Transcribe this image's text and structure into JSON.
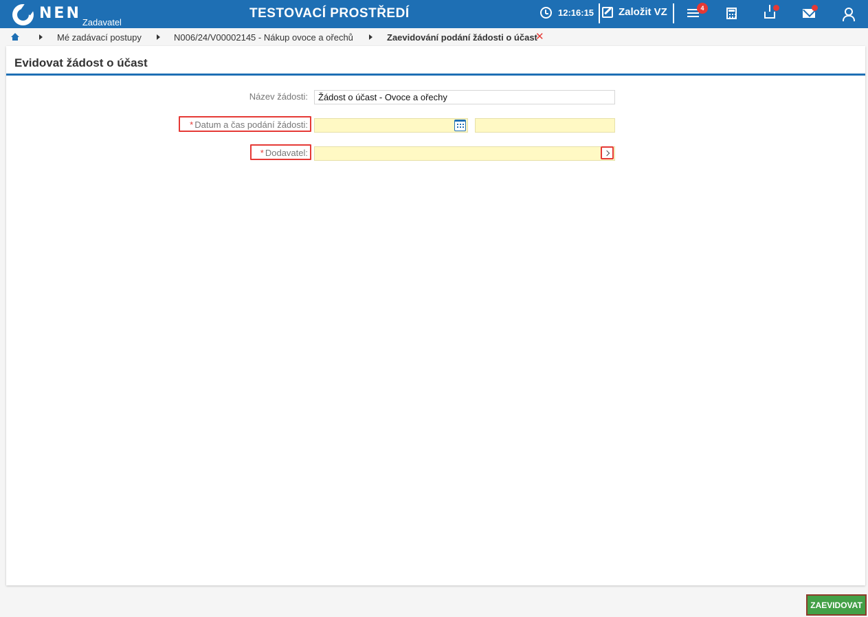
{
  "header": {
    "logo_text": "NEN",
    "logo_sub": "Zadavatel",
    "environment": "TESTOVACÍ PROSTŘEDÍ",
    "time": "12:16:15",
    "create_label": "Založit VZ",
    "notification_count": "4",
    "accent_color": "#1e6fb4"
  },
  "breadcrumb": {
    "items": [
      "Mé zadávací postupy",
      "N006/24/V00002145 - Nákup ovoce a ořechů",
      "Zaevidování podání žádosti o účast"
    ]
  },
  "page": {
    "title": "Evidovat žádost o účast"
  },
  "form": {
    "name_label": "Název žádosti:",
    "name_value": "Žádost o účast - Ovoce a ořechy",
    "datetime_star": "*",
    "datetime_label": "Datum a čas podání žádosti:",
    "date_value": "",
    "time_value": "",
    "supplier_star": "*",
    "supplier_label": "Dodavatel:",
    "supplier_value": ""
  },
  "actions": {
    "submit_label": "ZAEVIDOVAT"
  }
}
